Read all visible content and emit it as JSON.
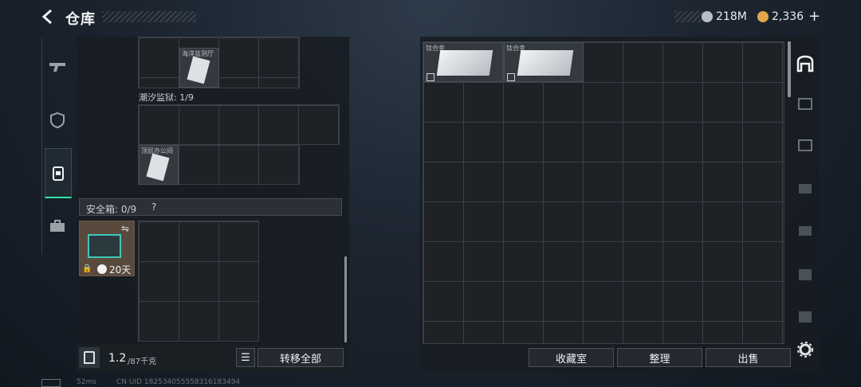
{
  "header": {
    "title": "仓库"
  },
  "currency": [
    {
      "value": "218M",
      "color": "#b8bec4"
    },
    {
      "value": "2,336",
      "color": "#e0a84a"
    }
  ],
  "left_tabs": [
    {
      "icon": "gun-icon",
      "active": false
    },
    {
      "icon": "armor-icon",
      "active": false
    },
    {
      "icon": "backpack-icon",
      "active": true
    },
    {
      "icon": "briefcase-icon",
      "active": false
    }
  ],
  "left_panel": {
    "section1_item_label": "海洋监测厅",
    "section2_title": "潮汐监狱: 1/9",
    "section2_item_label": "顶层办公间",
    "safe_box_title": "安全箱: 0/9",
    "safe_box_help": "?",
    "safe_box_duration": "20天",
    "weight": "1.2",
    "weight_max": "/87千克",
    "transfer_all": "转移全部"
  },
  "right_panel": {
    "items": [
      {
        "label": "钛合金"
      },
      {
        "label": "钛合金"
      }
    ],
    "buttons": {
      "collection": "收藏室",
      "sort": "整理",
      "sell": "出售"
    }
  },
  "side_filters": [
    "home-icon",
    "ammo-iv-icon",
    "ammo-v-icon",
    "container-iv-icon",
    "container-icon",
    "medkit-iv-icon",
    "armor-iv-icon"
  ],
  "footer": {
    "ping": "52ms",
    "uid": "CN UID 182534055558316183494"
  },
  "accent_color": "#2ee6a8"
}
